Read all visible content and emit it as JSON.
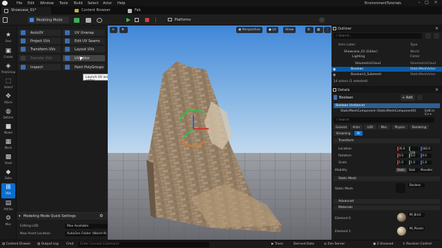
{
  "menubar": {
    "items": [
      "File",
      "Edit",
      "Window",
      "Tools",
      "Build",
      "Select",
      "Actor",
      "Help"
    ],
    "project": "EnvironmentTutorials"
  },
  "tabs": [
    {
      "label": "Showcase_01*"
    },
    {
      "label": "Content Browser"
    },
    {
      "label": "Fab"
    }
  ],
  "toolbar": {
    "mode": "Modeling Mode",
    "platforms": "Platforms"
  },
  "left_icons": [
    "Favs",
    "Create",
    "PolyGroup",
    "Select",
    "Xform",
    "Deform",
    "Model",
    "Mesh",
    "Voxel",
    "Bake",
    "UVs",
    "Attribs",
    "Misc"
  ],
  "tools": {
    "col1": [
      "AutoUV",
      "Project UVs",
      "Transform UVs",
      "Transfer UVs",
      "Inspect"
    ],
    "col2": [
      "UV Unwrap",
      "Edit UV Seams",
      "Layout UVs",
      "UVEditor",
      "Paint PolyGroups"
    ]
  },
  "tooltip": "Launch UV asset editor",
  "quick": {
    "header": "Modeling Mode Quick Settings",
    "rows": [
      {
        "label": "Editing LOD",
        "value": "Max Available"
      },
      {
        "label": "New Asset Location",
        "value": "AutoGen Folder (World-Relativ"
      }
    ]
  },
  "viewport": {
    "perspective": "Perspective",
    "lit": "Lit",
    "show": "Show"
  },
  "outliner": {
    "title": "Outliner",
    "search": "Search...",
    "col_label": "Item Label",
    "col_type": "Type",
    "rows": [
      {
        "name": "Showcase_01 (Editor)",
        "type": "World"
      },
      {
        "name": "Lighting",
        "type": "Folder"
      },
      {
        "name": "VolumetricCloud",
        "type": "VolumetricCloud"
      },
      {
        "name": "Boolean",
        "type": "StaticMeshActor"
      },
      {
        "name": "Boolean3_Submesh",
        "type": "StaticMeshActor"
      }
    ],
    "count": "14 actors (1 selected)"
  },
  "details": {
    "title": "Details",
    "actor": "Boolean",
    "add": "+ Add",
    "comp_instance": "Boolean (Instance)",
    "comp_mesh": "StaticMeshComponent (StaticMeshComponent0)",
    "comp_edit": "Edit in C++",
    "search": "Search",
    "filter_tabs": [
      "General",
      "Actor",
      "LOD",
      "Misc",
      "Physics",
      "Rendering",
      "Streaming",
      "All"
    ],
    "transform": "Transform",
    "location_label": "Location",
    "location": [
      "35.0",
      "-539.",
      "182.0"
    ],
    "rotation_label": "Rotation",
    "rotation": [
      "0.0",
      "0.0",
      "0.0"
    ],
    "scale_label": "Scale",
    "scale": [
      "1.0",
      "1.0",
      "1.0"
    ],
    "mobility_label": "Mobility",
    "mobility": [
      "Static",
      "Stationary",
      "Movable"
    ],
    "static_mesh_section": "Static Mesh",
    "static_mesh_label": "Static Mesh",
    "static_mesh_value": "Boolean",
    "advanced": "Advanced",
    "materials": "Materials",
    "element0": "Element 0",
    "element1": "Element 1",
    "mat0": "MI_Brick",
    "mat1": "MI_Plaster"
  },
  "bottombar": {
    "content_drawer": "Content Drawer",
    "output_log": "Output Log",
    "cmd": "Cmd",
    "cmd_placeholder": "Enter Console Command",
    "trace": "Trace",
    "derived_data": "Derived Data",
    "zen": "Zen Server",
    "unsaved": "2 Unsaved",
    "revision": "Revision Control"
  },
  "colors": {
    "accent": "#0a6ed1",
    "selection": "#0a5aa8",
    "play": "#3fbf3f"
  }
}
